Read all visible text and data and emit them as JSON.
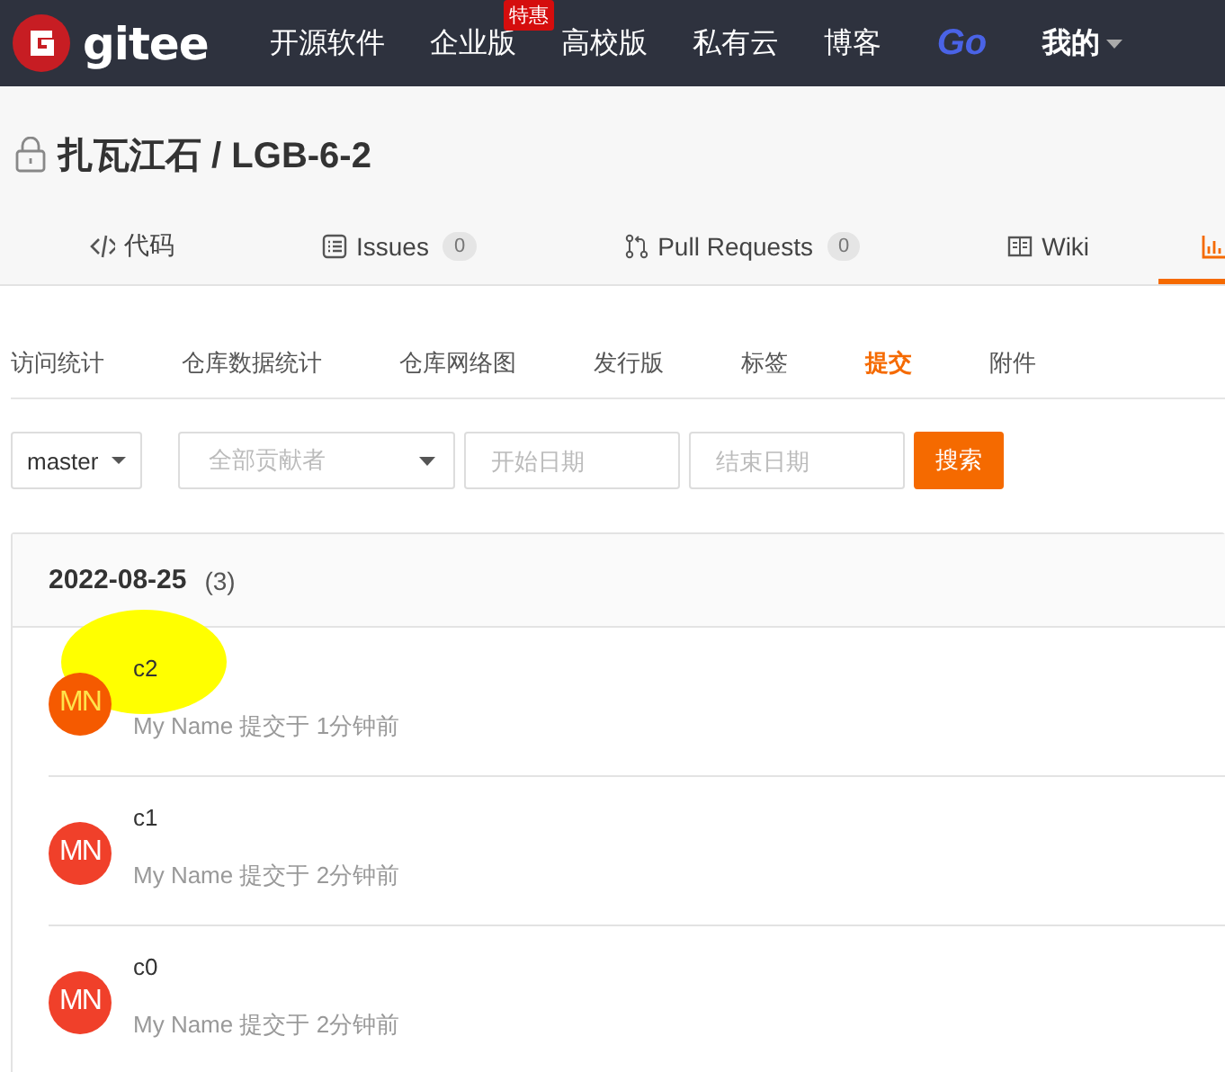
{
  "top_nav": {
    "logo": "gitee",
    "items": [
      {
        "label": "开源软件",
        "kind": "link"
      },
      {
        "label": "企业版",
        "kind": "link",
        "badge": "特惠"
      },
      {
        "label": "高校版",
        "kind": "link"
      },
      {
        "label": "私有云",
        "kind": "link"
      },
      {
        "label": "博客",
        "kind": "link"
      },
      {
        "label": "Go",
        "kind": "logo"
      },
      {
        "label": "我的",
        "kind": "menu"
      }
    ]
  },
  "repo": {
    "title": "扎瓦江石 / LGB-6-2",
    "private": true
  },
  "tabs": [
    {
      "label": "代码",
      "kind": "code",
      "selected": false
    },
    {
      "label": "Issues",
      "kind": "issues",
      "count": "0",
      "selected": false
    },
    {
      "label": "Pull Requests",
      "kind": "pulls",
      "count": "0",
      "selected": false
    },
    {
      "label": "Wiki",
      "kind": "wiki",
      "selected": false
    },
    {
      "kind": "stats",
      "selected": true
    }
  ],
  "sub_nav": [
    {
      "label": "访问统计",
      "selected": false
    },
    {
      "label": "仓库数据统计",
      "selected": false
    },
    {
      "label": "仓库网络图",
      "selected": false
    },
    {
      "label": "发行版",
      "selected": false
    },
    {
      "label": "标签",
      "selected": false
    },
    {
      "label": "提交",
      "selected": true
    },
    {
      "label": "附件",
      "selected": false
    }
  ],
  "filters": {
    "branch": "master",
    "contributors": {
      "placeholder": "全部贡献者"
    },
    "start_date": {
      "placeholder": "开始日期"
    },
    "end_date": {
      "placeholder": "结束日期"
    },
    "search_button": "搜索"
  },
  "commit_groups": [
    {
      "date": "2022-08-25",
      "count": "(3)",
      "commits": [
        {
          "title": "c2",
          "avatar": "MN",
          "meta": "My Name 提交于 1分钟前",
          "highlighted": true
        },
        {
          "title": "c1",
          "avatar": "MN",
          "meta": "My Name 提交于 2分钟前",
          "highlighted": false
        },
        {
          "title": "c0",
          "avatar": "MN",
          "meta": "My Name 提交于 2分钟前",
          "highlighted": false
        }
      ]
    }
  ]
}
